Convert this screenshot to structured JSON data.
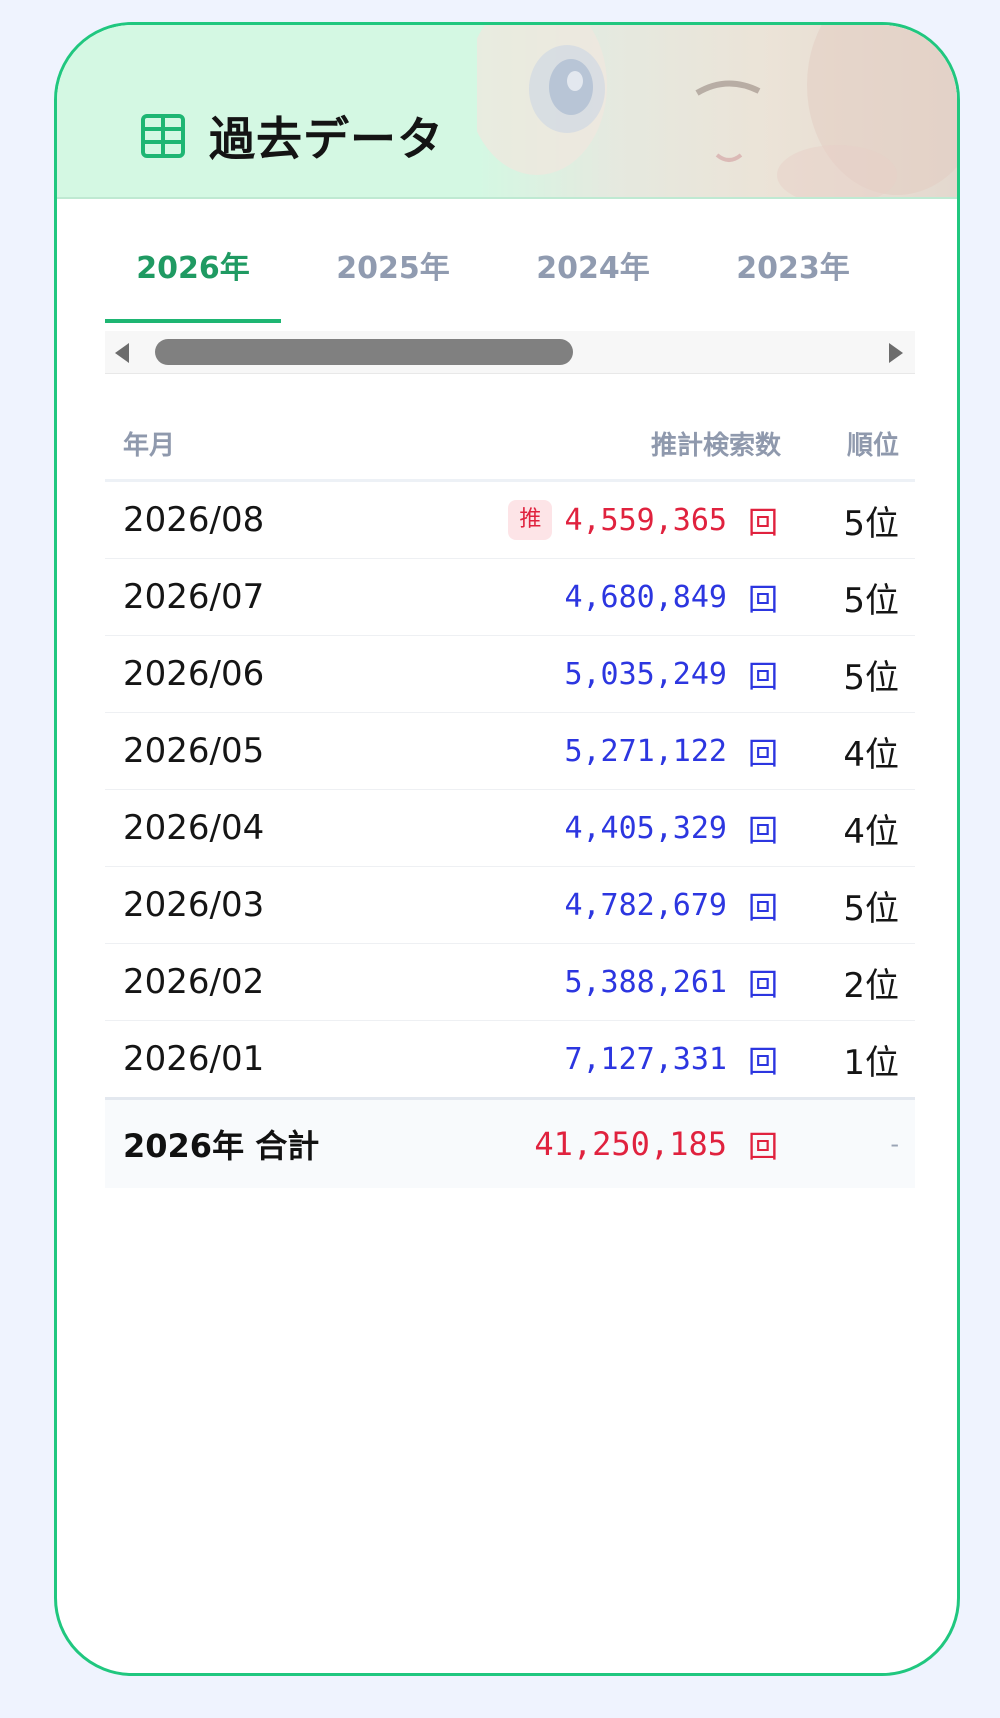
{
  "header": {
    "title": "過去データ",
    "icon": "table-grid-icon",
    "accent_color": "#1eb673"
  },
  "tabs": [
    {
      "label": "2026年",
      "active": true
    },
    {
      "label": "2025年",
      "active": false
    },
    {
      "label": "2024年",
      "active": false
    },
    {
      "label": "2023年",
      "active": false
    }
  ],
  "table": {
    "headers": {
      "month": "年月",
      "count": "推計検索数",
      "rank": "順位"
    },
    "rows": [
      {
        "month": "2026/08",
        "badge": "推",
        "count": "4,559,365",
        "unit": "回",
        "rank": "5位"
      },
      {
        "month": "2026/07",
        "count": "4,680,849",
        "unit": "回",
        "rank": "5位"
      },
      {
        "month": "2026/06",
        "count": "5,035,249",
        "unit": "回",
        "rank": "5位"
      },
      {
        "month": "2026/05",
        "count": "5,271,122",
        "unit": "回",
        "rank": "4位"
      },
      {
        "month": "2026/04",
        "count": "4,405,329",
        "unit": "回",
        "rank": "4位"
      },
      {
        "month": "2026/03",
        "count": "4,782,679",
        "unit": "回",
        "rank": "5位"
      },
      {
        "month": "2026/02",
        "count": "5,388,261",
        "unit": "回",
        "rank": "2位"
      },
      {
        "month": "2026/01",
        "count": "7,127,331",
        "unit": "回",
        "rank": "1位"
      }
    ],
    "total": {
      "label": "2026年 合計",
      "count": "41,250,185",
      "unit": "回",
      "rank": "-"
    }
  },
  "colors": {
    "estimate": "#e0223e",
    "count": "#2c36e0",
    "border": "#20c77f"
  }
}
